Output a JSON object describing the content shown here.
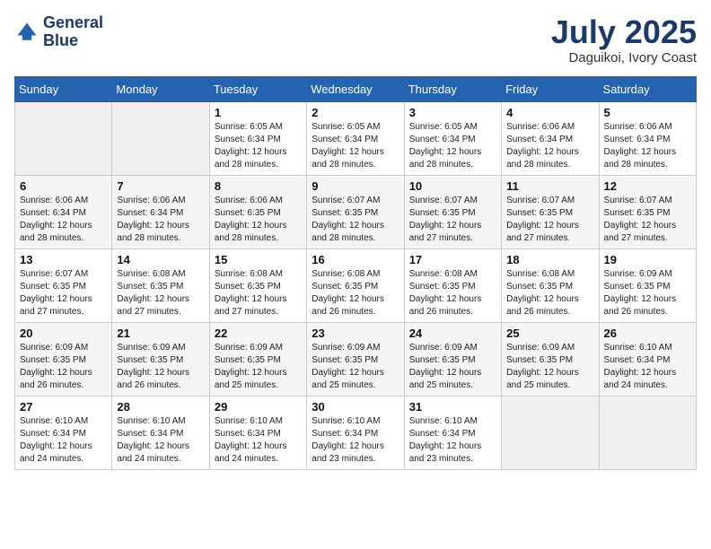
{
  "header": {
    "logo_line1": "General",
    "logo_line2": "Blue",
    "month": "July 2025",
    "location": "Daguikoi, Ivory Coast"
  },
  "weekdays": [
    "Sunday",
    "Monday",
    "Tuesday",
    "Wednesday",
    "Thursday",
    "Friday",
    "Saturday"
  ],
  "weeks": [
    [
      {
        "day": "",
        "sunrise": "",
        "sunset": "",
        "daylight": ""
      },
      {
        "day": "",
        "sunrise": "",
        "sunset": "",
        "daylight": ""
      },
      {
        "day": "1",
        "sunrise": "Sunrise: 6:05 AM",
        "sunset": "Sunset: 6:34 PM",
        "daylight": "Daylight: 12 hours and 28 minutes."
      },
      {
        "day": "2",
        "sunrise": "Sunrise: 6:05 AM",
        "sunset": "Sunset: 6:34 PM",
        "daylight": "Daylight: 12 hours and 28 minutes."
      },
      {
        "day": "3",
        "sunrise": "Sunrise: 6:05 AM",
        "sunset": "Sunset: 6:34 PM",
        "daylight": "Daylight: 12 hours and 28 minutes."
      },
      {
        "day": "4",
        "sunrise": "Sunrise: 6:06 AM",
        "sunset": "Sunset: 6:34 PM",
        "daylight": "Daylight: 12 hours and 28 minutes."
      },
      {
        "day": "5",
        "sunrise": "Sunrise: 6:06 AM",
        "sunset": "Sunset: 6:34 PM",
        "daylight": "Daylight: 12 hours and 28 minutes."
      }
    ],
    [
      {
        "day": "6",
        "sunrise": "Sunrise: 6:06 AM",
        "sunset": "Sunset: 6:34 PM",
        "daylight": "Daylight: 12 hours and 28 minutes."
      },
      {
        "day": "7",
        "sunrise": "Sunrise: 6:06 AM",
        "sunset": "Sunset: 6:34 PM",
        "daylight": "Daylight: 12 hours and 28 minutes."
      },
      {
        "day": "8",
        "sunrise": "Sunrise: 6:06 AM",
        "sunset": "Sunset: 6:35 PM",
        "daylight": "Daylight: 12 hours and 28 minutes."
      },
      {
        "day": "9",
        "sunrise": "Sunrise: 6:07 AM",
        "sunset": "Sunset: 6:35 PM",
        "daylight": "Daylight: 12 hours and 28 minutes."
      },
      {
        "day": "10",
        "sunrise": "Sunrise: 6:07 AM",
        "sunset": "Sunset: 6:35 PM",
        "daylight": "Daylight: 12 hours and 27 minutes."
      },
      {
        "day": "11",
        "sunrise": "Sunrise: 6:07 AM",
        "sunset": "Sunset: 6:35 PM",
        "daylight": "Daylight: 12 hours and 27 minutes."
      },
      {
        "day": "12",
        "sunrise": "Sunrise: 6:07 AM",
        "sunset": "Sunset: 6:35 PM",
        "daylight": "Daylight: 12 hours and 27 minutes."
      }
    ],
    [
      {
        "day": "13",
        "sunrise": "Sunrise: 6:07 AM",
        "sunset": "Sunset: 6:35 PM",
        "daylight": "Daylight: 12 hours and 27 minutes."
      },
      {
        "day": "14",
        "sunrise": "Sunrise: 6:08 AM",
        "sunset": "Sunset: 6:35 PM",
        "daylight": "Daylight: 12 hours and 27 minutes."
      },
      {
        "day": "15",
        "sunrise": "Sunrise: 6:08 AM",
        "sunset": "Sunset: 6:35 PM",
        "daylight": "Daylight: 12 hours and 27 minutes."
      },
      {
        "day": "16",
        "sunrise": "Sunrise: 6:08 AM",
        "sunset": "Sunset: 6:35 PM",
        "daylight": "Daylight: 12 hours and 26 minutes."
      },
      {
        "day": "17",
        "sunrise": "Sunrise: 6:08 AM",
        "sunset": "Sunset: 6:35 PM",
        "daylight": "Daylight: 12 hours and 26 minutes."
      },
      {
        "day": "18",
        "sunrise": "Sunrise: 6:08 AM",
        "sunset": "Sunset: 6:35 PM",
        "daylight": "Daylight: 12 hours and 26 minutes."
      },
      {
        "day": "19",
        "sunrise": "Sunrise: 6:09 AM",
        "sunset": "Sunset: 6:35 PM",
        "daylight": "Daylight: 12 hours and 26 minutes."
      }
    ],
    [
      {
        "day": "20",
        "sunrise": "Sunrise: 6:09 AM",
        "sunset": "Sunset: 6:35 PM",
        "daylight": "Daylight: 12 hours and 26 minutes."
      },
      {
        "day": "21",
        "sunrise": "Sunrise: 6:09 AM",
        "sunset": "Sunset: 6:35 PM",
        "daylight": "Daylight: 12 hours and 26 minutes."
      },
      {
        "day": "22",
        "sunrise": "Sunrise: 6:09 AM",
        "sunset": "Sunset: 6:35 PM",
        "daylight": "Daylight: 12 hours and 25 minutes."
      },
      {
        "day": "23",
        "sunrise": "Sunrise: 6:09 AM",
        "sunset": "Sunset: 6:35 PM",
        "daylight": "Daylight: 12 hours and 25 minutes."
      },
      {
        "day": "24",
        "sunrise": "Sunrise: 6:09 AM",
        "sunset": "Sunset: 6:35 PM",
        "daylight": "Daylight: 12 hours and 25 minutes."
      },
      {
        "day": "25",
        "sunrise": "Sunrise: 6:09 AM",
        "sunset": "Sunset: 6:35 PM",
        "daylight": "Daylight: 12 hours and 25 minutes."
      },
      {
        "day": "26",
        "sunrise": "Sunrise: 6:10 AM",
        "sunset": "Sunset: 6:34 PM",
        "daylight": "Daylight: 12 hours and 24 minutes."
      }
    ],
    [
      {
        "day": "27",
        "sunrise": "Sunrise: 6:10 AM",
        "sunset": "Sunset: 6:34 PM",
        "daylight": "Daylight: 12 hours and 24 minutes."
      },
      {
        "day": "28",
        "sunrise": "Sunrise: 6:10 AM",
        "sunset": "Sunset: 6:34 PM",
        "daylight": "Daylight: 12 hours and 24 minutes."
      },
      {
        "day": "29",
        "sunrise": "Sunrise: 6:10 AM",
        "sunset": "Sunset: 6:34 PM",
        "daylight": "Daylight: 12 hours and 24 minutes."
      },
      {
        "day": "30",
        "sunrise": "Sunrise: 6:10 AM",
        "sunset": "Sunset: 6:34 PM",
        "daylight": "Daylight: 12 hours and 23 minutes."
      },
      {
        "day": "31",
        "sunrise": "Sunrise: 6:10 AM",
        "sunset": "Sunset: 6:34 PM",
        "daylight": "Daylight: 12 hours and 23 minutes."
      },
      {
        "day": "",
        "sunrise": "",
        "sunset": "",
        "daylight": ""
      },
      {
        "day": "",
        "sunrise": "",
        "sunset": "",
        "daylight": ""
      }
    ]
  ]
}
